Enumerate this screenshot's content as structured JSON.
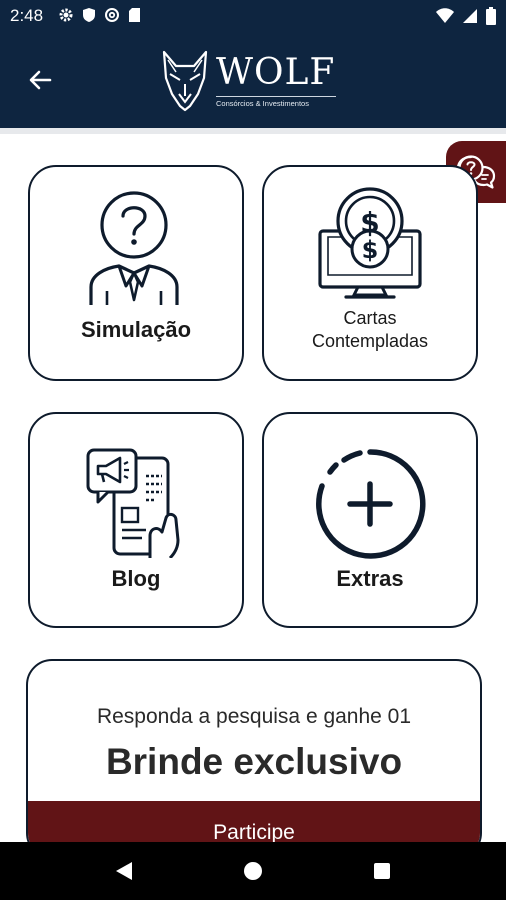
{
  "status_bar": {
    "time": "2:48",
    "left_icons": [
      "gear-icon",
      "shield-icon",
      "at-sign-icon",
      "sd-card-icon"
    ],
    "right_icons": [
      "wifi-icon",
      "signal-icon",
      "battery-icon"
    ]
  },
  "header": {
    "back_icon": "arrow-left-icon",
    "logo_word": "WOLF",
    "logo_sub": "Consórcios & Investimentos",
    "brand_color": "#0e2540"
  },
  "help_button": {
    "icon": "chat-help-icon",
    "color": "#611416"
  },
  "tiles": [
    {
      "label": "Simulação",
      "icon": "person-question-icon"
    },
    {
      "label": "Cartas",
      "label2": "Contempladas",
      "icon": "monitor-dollar-icon"
    },
    {
      "label": "Blog",
      "icon": "phone-megaphone-icon"
    },
    {
      "label": "Extras",
      "icon": "circle-plus-icon"
    }
  ],
  "promo": {
    "subtitle": "Responda a pesquisa e ganhe 01",
    "title": "Brinde exclusivo",
    "button_label": "Participe",
    "accent": "#611416"
  },
  "nav": {
    "back": "triangle-back-icon",
    "home": "circle-home-icon",
    "recents": "square-recents-icon"
  }
}
